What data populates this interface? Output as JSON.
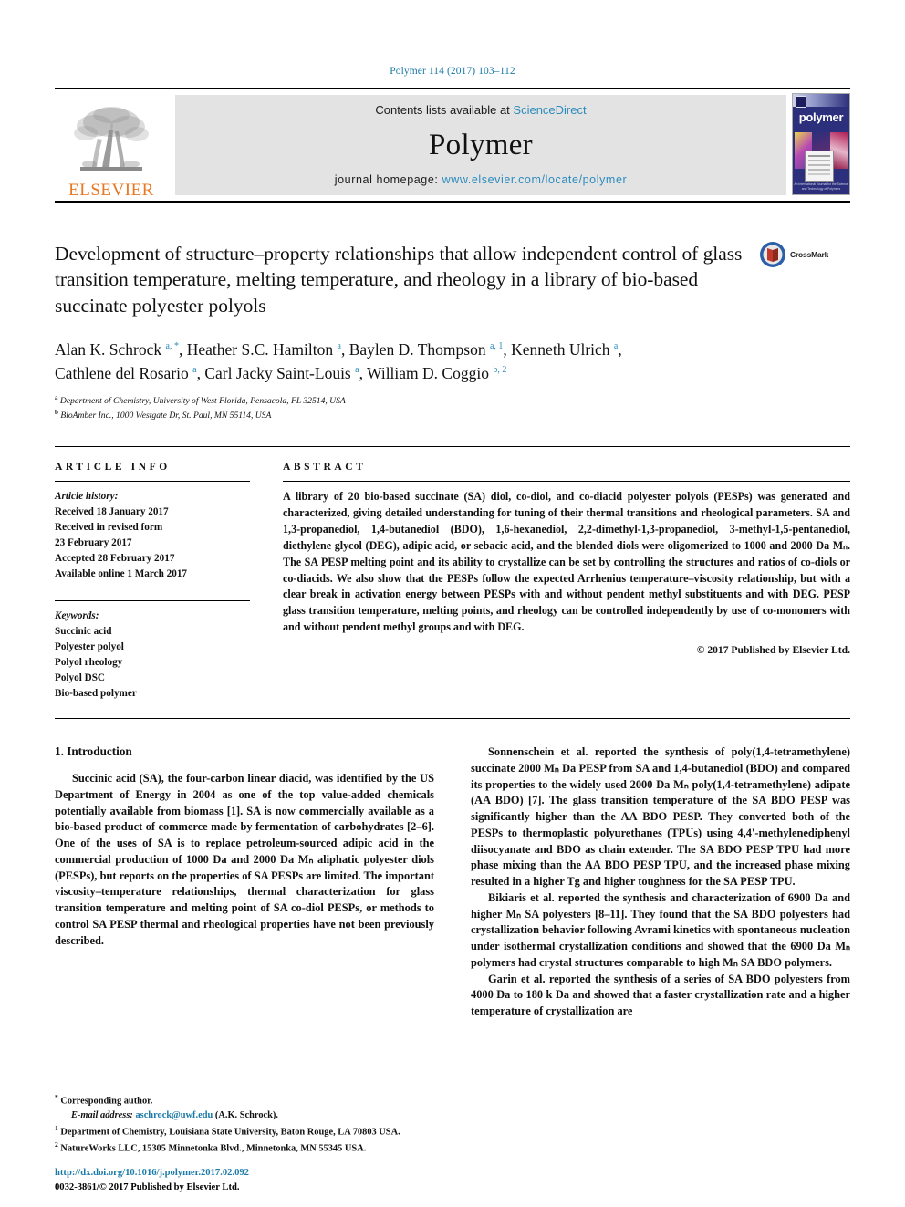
{
  "running_head": "Polymer 114 (2017) 103–112",
  "masthead": {
    "publisher_logo_text": "ELSEVIER",
    "contents_prefix": "Contents lists available at ",
    "contents_link": "ScienceDirect",
    "journal_name": "Polymer",
    "homepage_prefix": "journal homepage: ",
    "homepage_url": "www.elsevier.com/locate/polymer",
    "cover_title": "polymer",
    "cover_footer": "An International Journal for the\nScience and Technology of Polymers"
  },
  "article": {
    "title": "Development of structure–property relationships that allow independent control of glass transition temperature, melting temperature, and rheology in a library of bio-based succinate polyester polyols",
    "crossmark_label": "CrossMark",
    "authors_line1": "Alan K. Schrock",
    "authors_html": "Alan K. Schrock <sup>a, *</sup>, Heather S.C. Hamilton <sup>a</sup>, Baylen D. Thompson <sup>a, 1</sup>, Kenneth Ulrich <sup>a</sup>, Cathlene del Rosario <sup>a</sup>, Carl Jacky Saint-Louis <sup>a</sup>, William D. Coggio <sup>b, 2</sup>",
    "affiliation_a": "Department of Chemistry, University of West Florida, Pensacola, FL 32514, USA",
    "affiliation_b": "BioAmber Inc., 1000 Westgate Dr, St. Paul, MN 55114, USA"
  },
  "article_info": {
    "heading": "ARTICLE INFO",
    "history_label": "Article history:",
    "history": [
      "Received 18 January 2017",
      "Received in revised form",
      "23 February 2017",
      "Accepted 28 February 2017",
      "Available online 1 March 2017"
    ],
    "keywords_label": "Keywords:",
    "keywords": [
      "Succinic acid",
      "Polyester polyol",
      "Polyol rheology",
      "Polyol DSC",
      "Bio-based polymer"
    ]
  },
  "abstract": {
    "heading": "ABSTRACT",
    "text": "A library of 20 bio-based succinate (SA) diol, co-diol, and co-diacid polyester polyols (PESPs) was generated and characterized, giving detailed understanding for tuning of their thermal transitions and rheological parameters. SA and 1,3-propanediol, 1,4-butanediol (BDO), 1,6-hexanediol, 2,2-dimethyl-1,3-propanediol, 3-methyl-1,5-pentanediol, diethylene glycol (DEG), adipic acid, or sebacic acid, and the blended diols were oligomerized to 1000 and 2000 Da Mₙ. The SA PESP melting point and its ability to crystallize can be set by controlling the structures and ratios of co-diols or co-diacids. We also show that the PESPs follow the expected Arrhenius temperature–viscosity relationship, but with a clear break in activation energy between PESPs with and without pendent methyl substituents and with DEG. PESP glass transition temperature, melting points, and rheology can be controlled independently by use of co-monomers with and without pendent methyl groups and with DEG.",
    "copyright": "© 2017 Published by Elsevier Ltd."
  },
  "body": {
    "section_number_title": "1. Introduction",
    "left_paragraphs": [
      "Succinic acid (SA), the four-carbon linear diacid, was identified by the US Department of Energy in 2004 as one of the top value-added chemicals potentially available from biomass [1]. SA is now commercially available as a bio-based product of commerce made by fermentation of carbohydrates [2–6]. One of the uses of SA is to replace petroleum-sourced adipic acid in the commercial production of 1000 Da and 2000 Da Mₙ aliphatic polyester diols (PESPs), but reports on the properties of SA PESPs are limited. The important viscosity–temperature relationships, thermal characterization for glass transition temperature and melting point of SA co-diol PESPs, or methods to control SA PESP thermal and rheological properties have not been previously described."
    ],
    "right_paragraphs": [
      "Sonnenschein et al. reported the synthesis of poly(1,4-tetramethylene) succinate 2000 Mₙ Da PESP from SA and 1,4-butanediol (BDO) and compared its properties to the widely used 2000 Da Mₙ poly(1,4-tetramethylene) adipate (AA BDO) [7]. The glass transition temperature of the SA BDO PESP was significantly higher than the AA BDO PESP. They converted both of the PESPs to thermoplastic polyurethanes (TPUs) using 4,4'-methylenediphenyl diisocyanate and BDO as chain extender. The SA BDO PESP TPU had more phase mixing than the AA BDO PESP TPU, and the increased phase mixing resulted in a higher Tg and higher toughness for the SA PESP TPU.",
      "Bikiaris et al. reported the synthesis and characterization of 6900 Da and higher Mₙ SA polyesters [8–11]. They found that the SA BDO polyesters had crystallization behavior following Avrami kinetics with spontaneous nucleation under isothermal crystallization conditions and showed that the 6900 Da Mₙ polymers had crystal structures comparable to high Mₙ SA BDO polymers.",
      "Garin et al. reported the synthesis of a series of SA BDO polyesters from 4000 Da to 180 k Da and showed that a faster crystallization rate and a higher temperature of crystallization are"
    ]
  },
  "footnotes": {
    "corresponding_marker": "*",
    "corresponding_text": "Corresponding author.",
    "email_label": "E-mail address:",
    "email": "aschrock@uwf.edu",
    "email_suffix": "(A.K. Schrock).",
    "note1_marker": "1",
    "note1_text": "Department of Chemistry, Louisiana State University, Baton Rouge, LA 70803 USA.",
    "note2_marker": "2",
    "note2_text": "NatureWorks LLC, 15305 Minnetonka Blvd., Minnetonka, MN 55345 USA."
  },
  "doi": {
    "url": "http://dx.doi.org/10.1016/j.polymer.2017.02.092",
    "issn_line": "0032-3861/© 2017 Published by Elsevier Ltd."
  },
  "colors": {
    "link_blue": "#1a7aa8",
    "elsevier_orange": "#E87722",
    "cover_navy": "#2c2f7b"
  }
}
